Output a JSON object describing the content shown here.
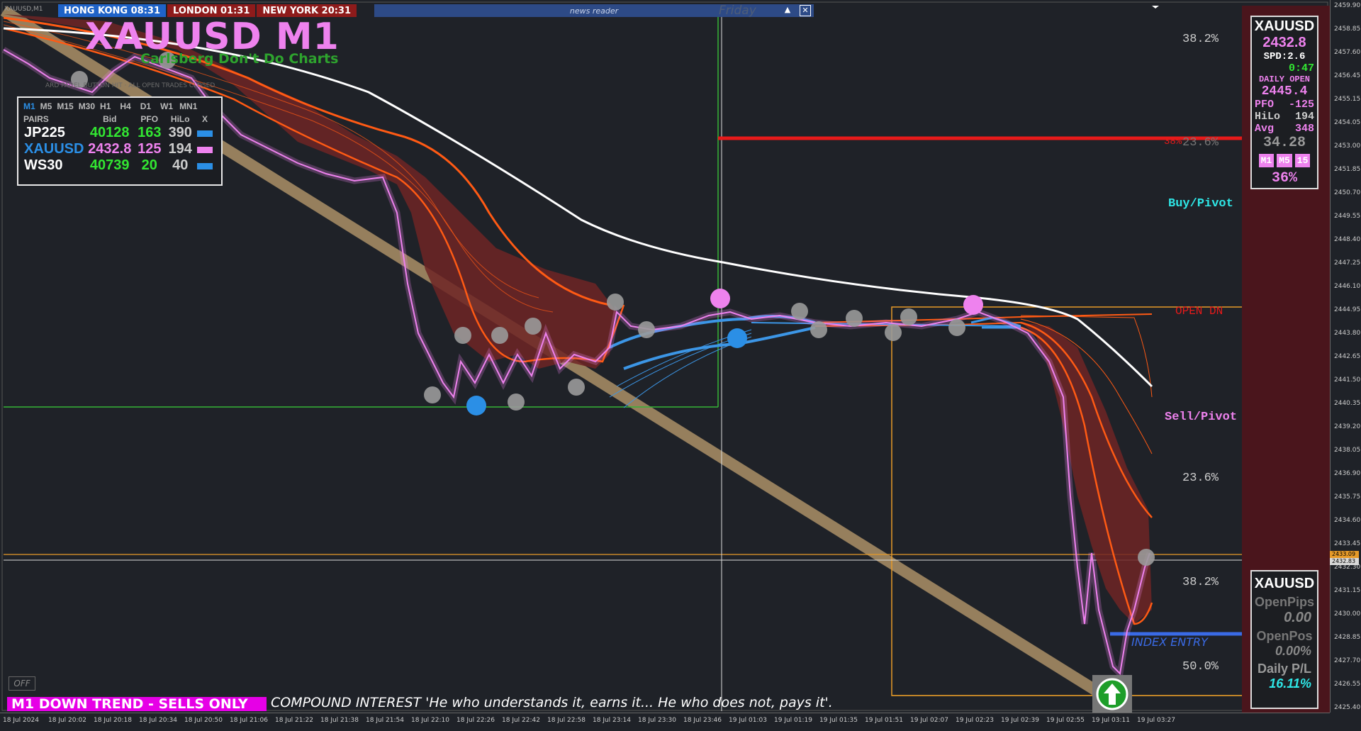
{
  "sessions": [
    {
      "label": "HONG KONG 08:31",
      "color": "#1f63c8"
    },
    {
      "label": "LONDON  01:31",
      "color": "#8e1b1b"
    },
    {
      "label": "NEW YORK 20:31",
      "color": "#8e1b1b"
    }
  ],
  "news": {
    "label": "news reader",
    "day": "Friday",
    "up_icon": "▲",
    "close_icon": "✕"
  },
  "chart_title": "XAUUSD M1",
  "chart_subtitle": "Carlsberg Don't Do Charts",
  "faint_text": "ARD PANEL BUTTON HIT · ALL OPEN TRADES CLOSED",
  "symbol_corner": "XAUUSD,M1",
  "pairs_panel": {
    "timeframes": [
      "M1",
      "M5",
      "M15",
      "M30",
      "H1",
      "H4",
      "D1",
      "W1",
      "MN1"
    ],
    "active_tf": "M1",
    "headers": [
      "PAIRS",
      "Bid",
      "PFO",
      "HiLo",
      "X"
    ],
    "rows": [
      {
        "pair": "JP225",
        "bid": "40128",
        "pfo": "163",
        "hilo": "390",
        "pair_color": "#ffffff",
        "bid_color": "#32e632",
        "pfo_color": "#32e632",
        "swatch": "#2b8fe6"
      },
      {
        "pair": "XAUUSD",
        "bid": "2432.8",
        "pfo": "125",
        "hilo": "194",
        "pair_color": "#2b8fe6",
        "bid_color": "#ee82ee",
        "pfo_color": "#ee82ee",
        "swatch": "#ee82ee"
      },
      {
        "pair": "WS30",
        "bid": "40739",
        "pfo": "20",
        "hilo": "40",
        "pair_color": "#ffffff",
        "bid_color": "#32e632",
        "pfo_color": "#32e632",
        "swatch": "#2b8fe6"
      }
    ]
  },
  "levels": {
    "fib_top": "38.2%",
    "fib_red": "38%",
    "fib_red2": "23.6%",
    "buy_pivot": "Buy/Pivot",
    "open_dn": "OPEN DN",
    "sell_pivot": "Sell/Pivot",
    "fib_236": "23.6%",
    "fib_382": "38.2%",
    "index_entry": "INDEX ENTRY",
    "fib_50": "50.0%"
  },
  "price_scale": [
    "2459.90",
    "2458.85",
    "2457.60",
    "2456.45",
    "2455.15",
    "2454.05",
    "2453.00",
    "2451.85",
    "2450.70",
    "2449.55",
    "2448.40",
    "2447.25",
    "2446.10",
    "2444.95",
    "2443.80",
    "2442.65",
    "2441.50",
    "2440.35",
    "2439.20",
    "2438.05",
    "2436.90",
    "2435.75",
    "2434.60",
    "2433.45",
    "2432.30",
    "2431.15",
    "2430.00",
    "2428.85",
    "2427.70",
    "2426.55",
    "2425.40"
  ],
  "price_tags": [
    "2433.09",
    "2432.83"
  ],
  "time_scale": [
    "18 Jul 2024",
    "18 Jul 20:02",
    "18 Jul 20:18",
    "18 Jul 20:34",
    "18 Jul 20:50",
    "18 Jul 21:06",
    "18 Jul 21:22",
    "18 Jul 21:38",
    "18 Jul 21:54",
    "18 Jul 22:10",
    "18 Jul 22:26",
    "18 Jul 22:42",
    "18 Jul 22:58",
    "18 Jul 23:14",
    "18 Jul 23:30",
    "18 Jul 23:46",
    "19 Jul 01:03",
    "19 Jul 01:19",
    "19 Jul 01:35",
    "19 Jul 01:51",
    "19 Jul 02:07",
    "19 Jul 02:23",
    "19 Jul 02:39",
    "19 Jul 02:55",
    "19 Jul 03:11",
    "19 Jul 03:27"
  ],
  "info_panel": {
    "symbol": "XAUUSD",
    "price": "2432.8",
    "spread": "SPD:2.6",
    "timer": "0:47",
    "daily_open_label": "DAILY OPEN",
    "daily_open": "2445.4",
    "pfo_label": "PFO",
    "pfo": "-125",
    "hilo_label": "HiLo",
    "hilo": "194",
    "avg_label": "Avg",
    "avg": "348",
    "value": "34.28",
    "tf_buttons": [
      "M1",
      "M5",
      "15"
    ],
    "percent": "36%"
  },
  "pos_panel": {
    "symbol": "XAUUSD",
    "open_pips_label": "OpenPips",
    "open_pips": "0.00",
    "open_pos_label": "OpenPos",
    "open_pos": "0.00%",
    "daily_pl_label": "Daily P/L",
    "daily_pl": "16.11%"
  },
  "off_button": "OFF",
  "trend_label": "M1  DOWN TREND - SELLS ONLY",
  "quote": "COMPOUND INTEREST  'He who understands it, earns it... He who does not, pays it'."
}
